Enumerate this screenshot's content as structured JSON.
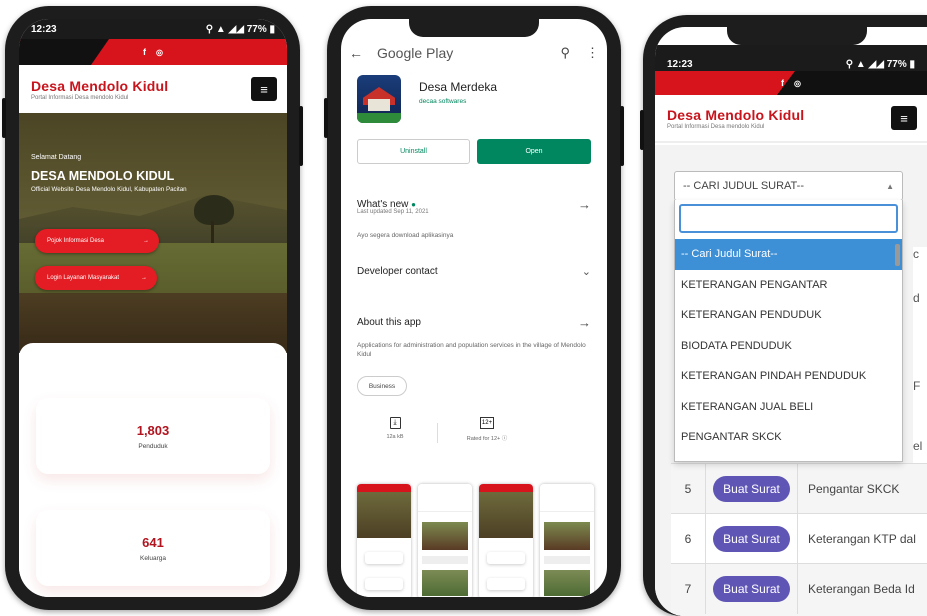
{
  "phone1": {
    "status_time": "12:23",
    "status_right": "77%",
    "social_icons": [
      "f",
      "◎"
    ],
    "site_title": "Desa Mendolo Kidul",
    "site_subtitle": "Portal Informasi Desa mendolo Kidul",
    "menu_icon": "≡",
    "hero_welcome": "Selamat Datang",
    "hero_title": "DESA MENDOLO KIDUL",
    "hero_desc": "Official Website Desa Mendolo Kidul, Kabupaten Pacitan",
    "btn_info": "Pojok Informasi Desa",
    "btn_login": "Login Layanan Masyarakat",
    "stat1_value": "1,803",
    "stat1_label": "Penduduk",
    "stat2_value": "641",
    "stat2_label": "Keluarga",
    "colors": {
      "brand_red": "#d7131c"
    }
  },
  "phone2": {
    "store_title": "Google Play",
    "app_name": "Desa Merdeka",
    "developer": "decaa softwares",
    "uninstall_label": "Uninstall",
    "open_label": "Open",
    "whats_new_title": "What's new",
    "whats_new_date": "Last updated Sep 11, 2021",
    "whats_new_text": "Ayo segera download aplikasinya",
    "developer_contact": "Developer contact",
    "about_title": "About this app",
    "about_text": "Applications for administration and population services in the village of Mendolo Kidul",
    "category_chip": "Business",
    "size_label": "12a kB",
    "rating_badge": "12+",
    "rating_label": "Rated for 12+ ⓘ",
    "colors": {
      "open_green": "#01875f"
    }
  },
  "phone3": {
    "status_time": "12:23",
    "status_right": "77%",
    "social_icons": [
      "f",
      "◎"
    ],
    "site_title": "Desa Mendolo Kidul",
    "site_subtitle": "Portal Informasi Desa mendolo Kidul",
    "menu_icon": "≡",
    "select_value": "-- CARI JUDUL SURAT--",
    "search_value": "",
    "options": [
      "-- Cari Judul Surat--",
      "KETERANGAN PENGANTAR",
      "KETERANGAN PENDUDUK",
      "BIODATA PENDUDUK",
      "KETERANGAN PINDAH PENDUDUK",
      "KETERANGAN JUAL BELI",
      "PENGANTAR SKCK"
    ],
    "behind_peek": [
      "c",
      "d",
      "",
      "F",
      "el"
    ],
    "rows": [
      {
        "no": "5",
        "action": "Buat Surat",
        "title": "Pengantar SKCK"
      },
      {
        "no": "6",
        "action": "Buat Surat",
        "title": "Keterangan KTP dal"
      },
      {
        "no": "7",
        "action": "Buat Surat",
        "title": "Keterangan Beda Id"
      }
    ],
    "colors": {
      "highlight_blue": "#3d8fd6",
      "pill_purple": "#5f55b5"
    }
  }
}
